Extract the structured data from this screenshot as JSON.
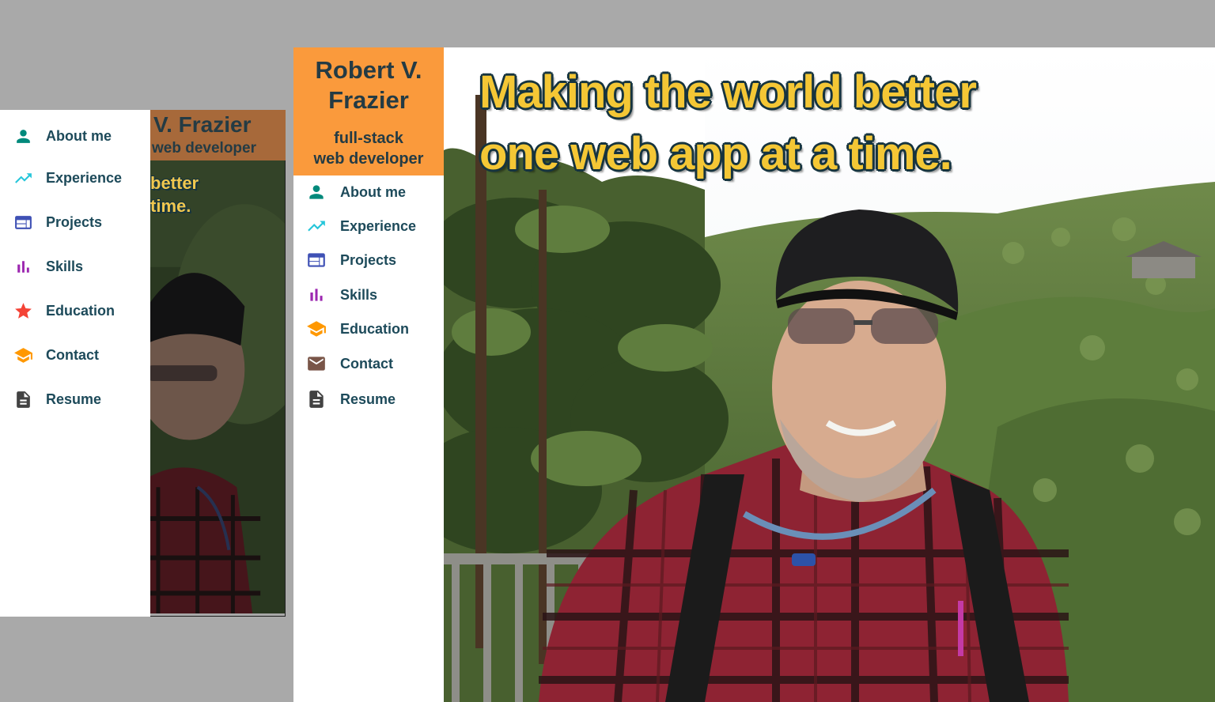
{
  "person": {
    "name_line1": "Robert V.",
    "name_line2": "Frazier",
    "title_line1": "full-stack",
    "title_line2": "web developer"
  },
  "hero": {
    "tagline_line1": "Making the world better",
    "tagline_line2": "one web app at a time."
  },
  "mobile": {
    "name_partial": "V. Frazier",
    "title_partial": "web developer",
    "tagline_partial_1": "better",
    "tagline_partial_2": "time.",
    "nav": [
      {
        "label": "About me",
        "icon": "person-icon",
        "color": "#00897b"
      },
      {
        "label": "Experience",
        "icon": "trending-up-icon",
        "color": "#26c6da"
      },
      {
        "label": "Projects",
        "icon": "web-window-icon",
        "color": "#3f51b5"
      },
      {
        "label": "Skills",
        "icon": "bar-chart-icon",
        "color": "#9c27b0"
      },
      {
        "label": "Education",
        "icon": "star-icon",
        "color": "#f44336"
      },
      {
        "label": "Contact",
        "icon": "graduation-cap-icon",
        "color": "#ff9800"
      },
      {
        "label": "Resume",
        "icon": "document-icon",
        "color": "#424242"
      }
    ]
  },
  "desktop_nav": [
    {
      "label": "About me",
      "icon": "person-icon",
      "color": "#00897b"
    },
    {
      "label": "Experience",
      "icon": "trending-up-icon",
      "color": "#26c6da"
    },
    {
      "label": "Projects",
      "icon": "web-window-icon",
      "color": "#3f51b5"
    },
    {
      "label": "Skills",
      "icon": "bar-chart-icon",
      "color": "#9c27b0"
    },
    {
      "label": "Education",
      "icon": "graduation-cap-icon",
      "color": "#ff9800"
    },
    {
      "label": "Contact",
      "icon": "mail-icon",
      "color": "#795548"
    },
    {
      "label": "Resume",
      "icon": "document-icon",
      "color": "#424242"
    }
  ],
  "colors": {
    "brand_orange": "#fa9a3c",
    "nav_text": "#1d4a5a",
    "tagline_yellow": "#f4c735",
    "tagline_outline": "#16343f"
  }
}
